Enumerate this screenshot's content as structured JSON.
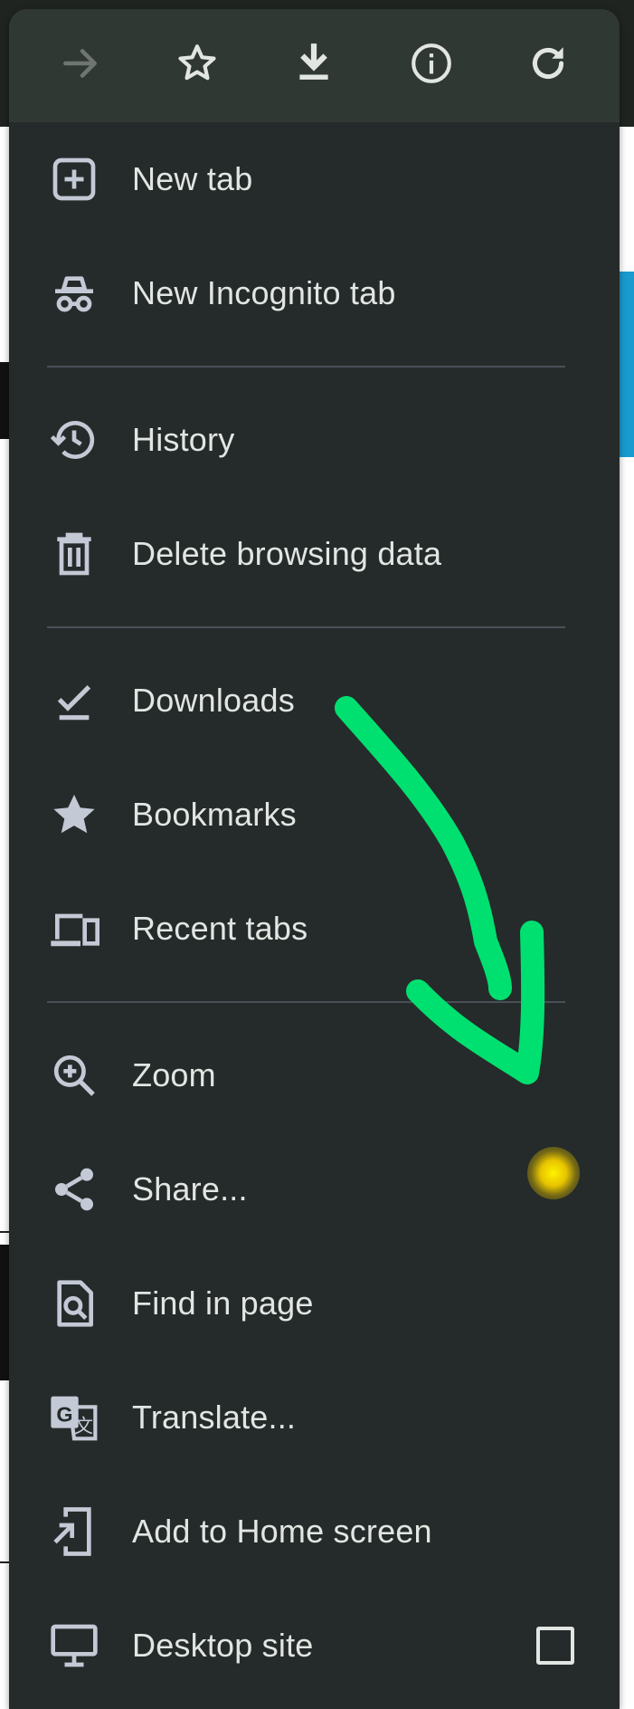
{
  "toolbar": {
    "buttons": [
      {
        "name": "forward",
        "icon": "arrow-right-icon"
      },
      {
        "name": "bookmark",
        "icon": "star-outline-icon"
      },
      {
        "name": "download",
        "icon": "download-icon"
      },
      {
        "name": "page-info",
        "icon": "info-icon"
      },
      {
        "name": "reload",
        "icon": "refresh-icon"
      }
    ]
  },
  "menu": {
    "items": [
      {
        "label": "New tab",
        "icon": "plus-box-icon"
      },
      {
        "label": "New Incognito tab",
        "icon": "incognito-icon"
      },
      {
        "label": "History",
        "icon": "history-icon"
      },
      {
        "label": "Delete browsing data",
        "icon": "trash-icon"
      },
      {
        "label": "Downloads",
        "icon": "download-check-icon"
      },
      {
        "label": "Bookmarks",
        "icon": "star-filled-icon"
      },
      {
        "label": "Recent tabs",
        "icon": "devices-icon"
      },
      {
        "label": "Zoom",
        "icon": "zoom-in-icon"
      },
      {
        "label": "Share...",
        "icon": "share-icon"
      },
      {
        "label": "Find in page",
        "icon": "find-in-page-icon"
      },
      {
        "label": "Translate...",
        "icon": "translate-icon"
      },
      {
        "label": "Add to Home screen",
        "icon": "add-to-home-icon"
      },
      {
        "label": "Desktop site",
        "icon": "monitor-icon"
      }
    ],
    "desktop_site_checked": false
  },
  "colors": {
    "menu_bg": "#252b2a",
    "toolbar_bg": "#303834",
    "text": "#e2e6e3",
    "icon": "#c4c9d6",
    "divider": "#4a4f58",
    "annotation_arrow": "#00e070",
    "tap_indicator": "#f5d300"
  }
}
